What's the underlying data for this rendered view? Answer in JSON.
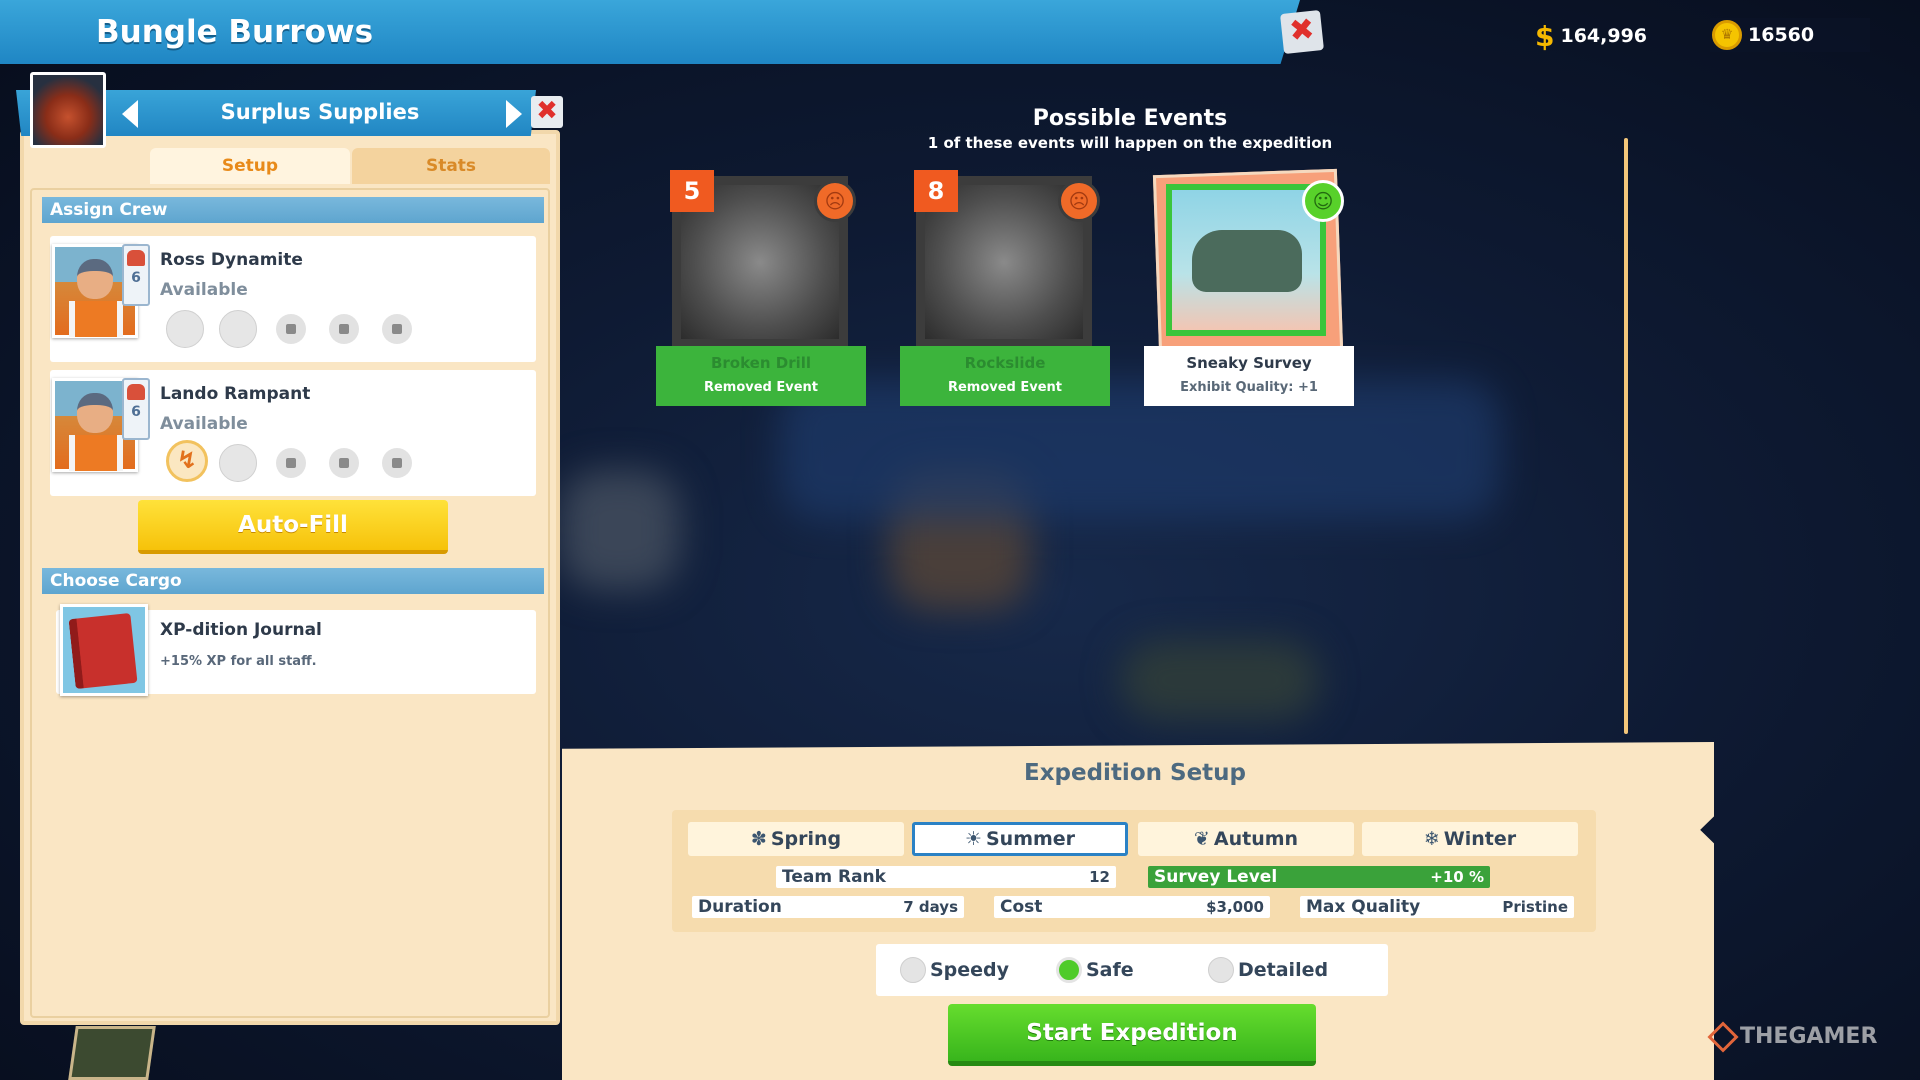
{
  "header": {
    "location": "Bungle Burrows",
    "close_icon": "close-icon",
    "money": "164,996",
    "money_symbol": "$",
    "coins": "16560"
  },
  "panel": {
    "title": "Surplus Supplies",
    "tabs": [
      {
        "label": "Setup",
        "active": true
      },
      {
        "label": "Stats",
        "active": false
      }
    ],
    "assign_crew_label": "Assign Crew",
    "crew": [
      {
        "name": "Ross Dynamite",
        "status": "Available",
        "rank": "6",
        "slots_filled": 0
      },
      {
        "name": "Lando Rampant",
        "status": "Available",
        "rank": "6",
        "slots_filled": 1
      }
    ],
    "autofill_label": "Auto-Fill",
    "choose_cargo_label": "Choose Cargo",
    "cargo": {
      "name": "XP-dition Journal",
      "description": "+15% XP for all staff."
    }
  },
  "events": {
    "title": "Possible Events",
    "subtitle": "1 of these events will happen on the expedition",
    "cards": [
      {
        "number": "5",
        "name": "Broken Drill",
        "effect": "Removed Event",
        "mood": "bad"
      },
      {
        "number": "8",
        "name": "Rockslide",
        "effect": "Removed Event",
        "mood": "bad"
      },
      {
        "number": "",
        "name": "Sneaky Survey",
        "effect": "Exhibit Quality: +1",
        "mood": "good"
      }
    ]
  },
  "setup": {
    "title": "Expedition Setup",
    "seasons": [
      {
        "label": "Spring",
        "icon": "✽",
        "selected": false
      },
      {
        "label": "Summer",
        "icon": "☀",
        "selected": true
      },
      {
        "label": "Autumn",
        "icon": "❦",
        "selected": false
      },
      {
        "label": "Winter",
        "icon": "❄",
        "selected": false
      }
    ],
    "team_rank_label": "Team Rank",
    "team_rank_value": "12",
    "survey_level_label": "Survey Level",
    "survey_level_value": "+10 %",
    "duration_label": "Duration",
    "duration_value": "7 days",
    "cost_label": "Cost",
    "cost_value": "$3,000",
    "max_quality_label": "Max Quality",
    "max_quality_value": "Pristine",
    "modes": [
      {
        "label": "Speedy",
        "selected": false
      },
      {
        "label": "Safe",
        "selected": true
      },
      {
        "label": "Detailed",
        "selected": false
      }
    ],
    "start_label": "Start Expedition"
  },
  "watermark": "THEGAMER",
  "colors": {
    "header_blue": "#2a95cf",
    "parchment": "#fae6c4",
    "autofill_yellow": "#fbd31e",
    "start_green": "#4ec824",
    "event_number_orange": "#f05a20"
  }
}
